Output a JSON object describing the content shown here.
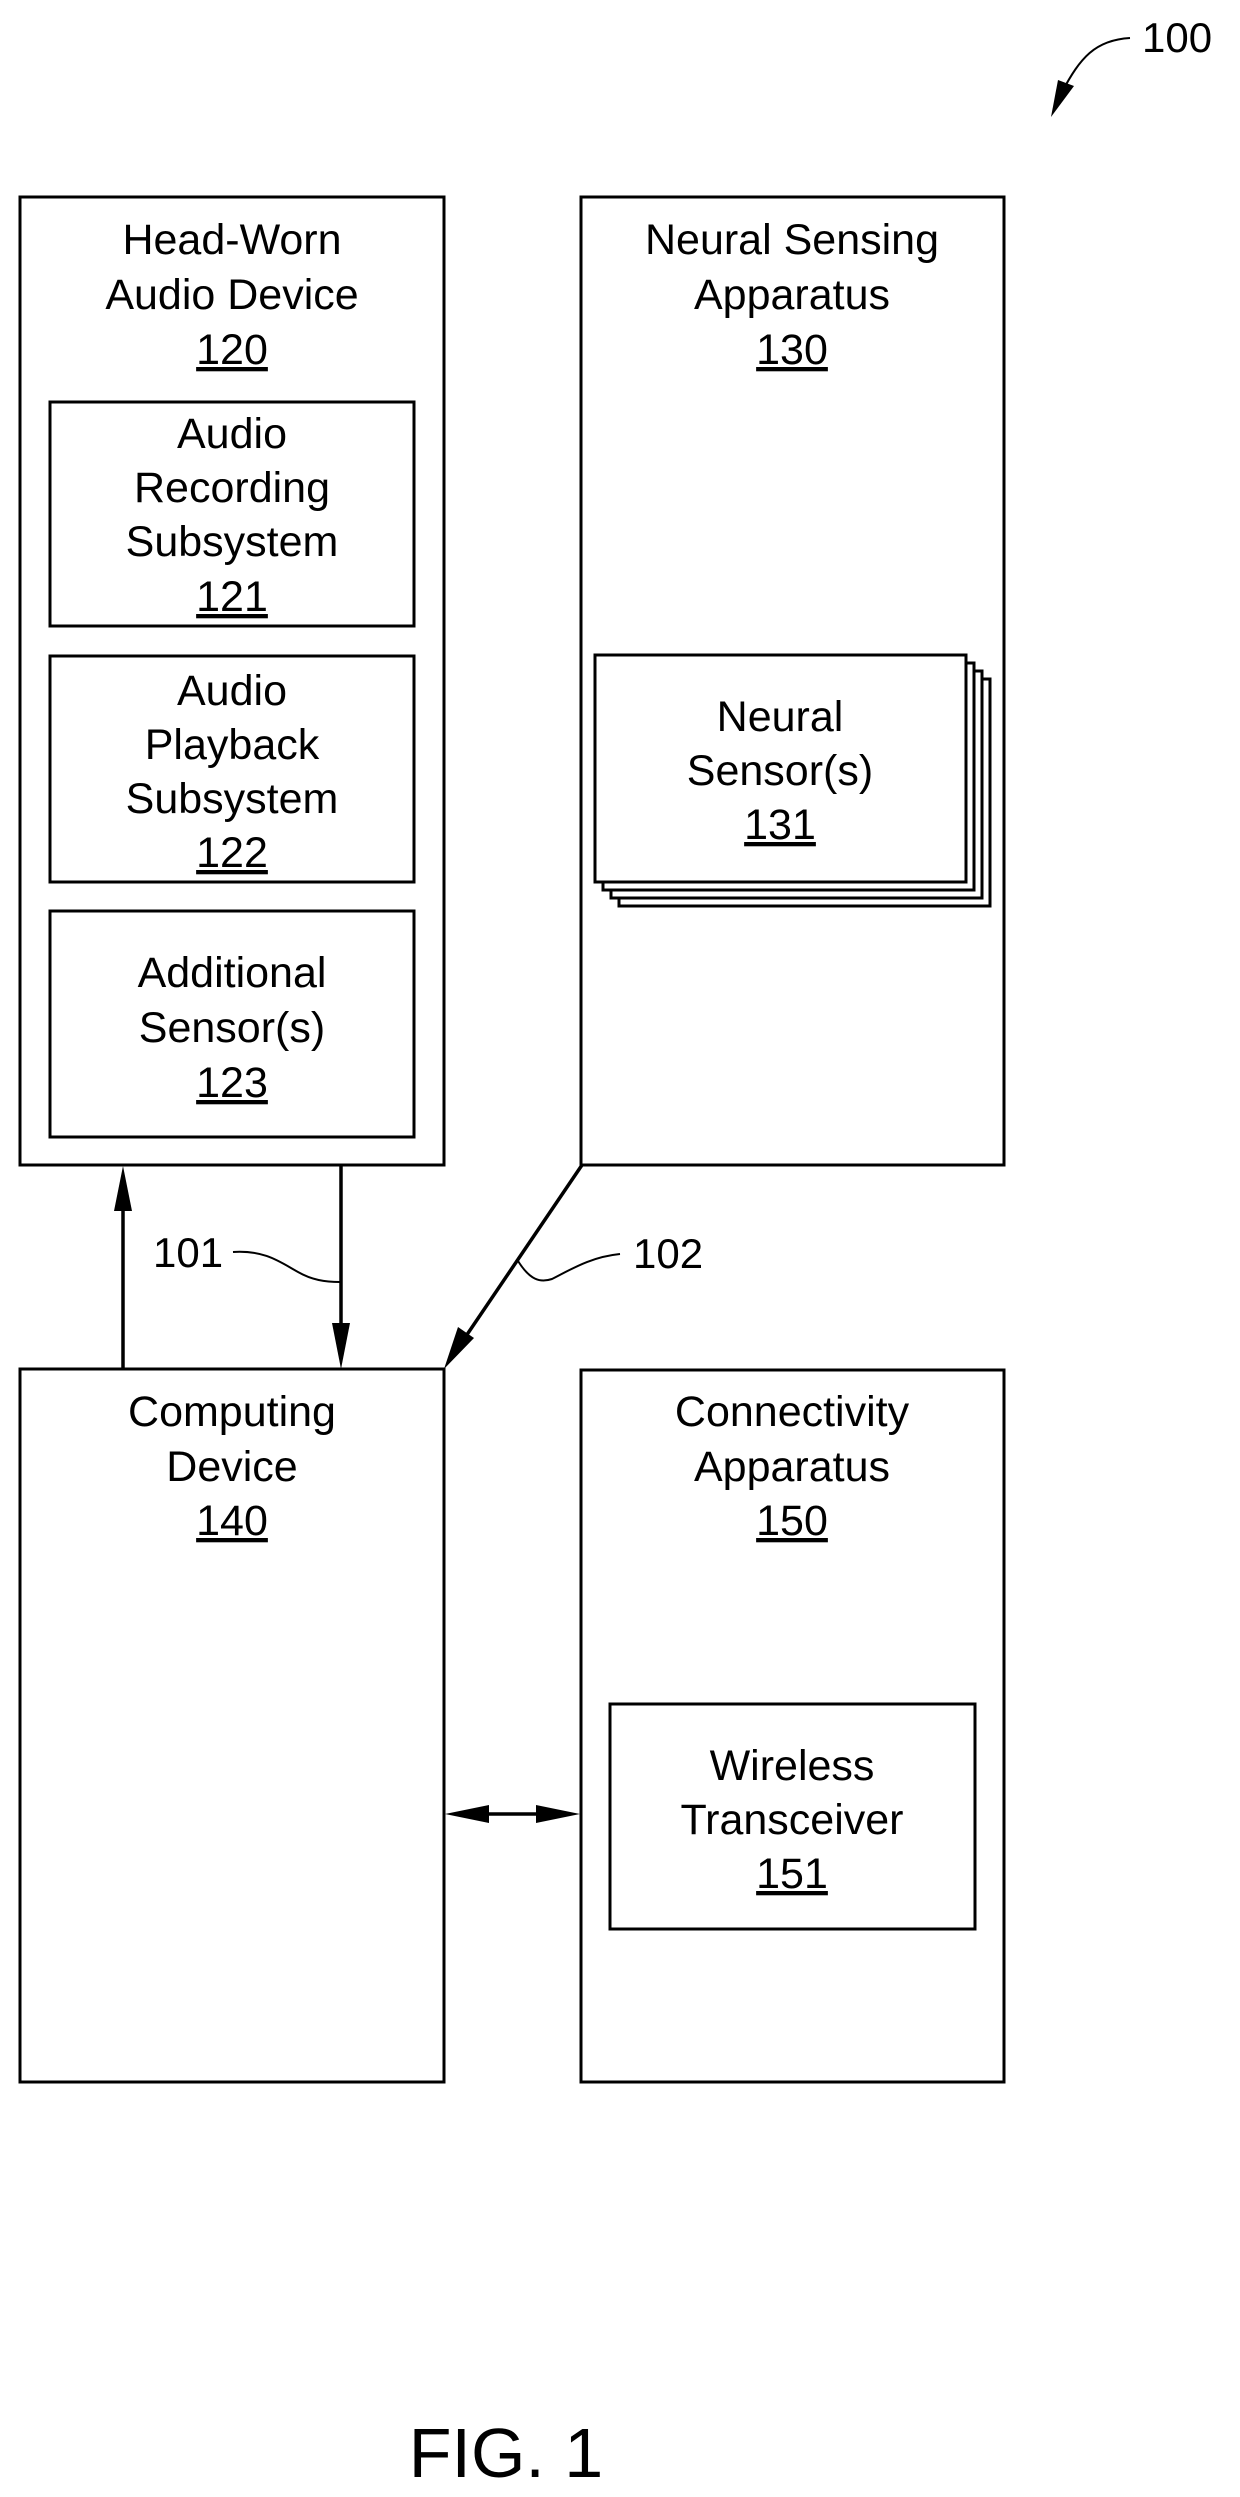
{
  "figure": {
    "reference": "100",
    "caption": "FIG. 1"
  },
  "connections": {
    "c101": {
      "label": "101",
      "description": "Bidirectional link between Head-Worn Audio Device and Computing Device"
    },
    "c102": {
      "label": "102",
      "description": "Link from Neural Sensing Apparatus to Computing Device"
    },
    "c140_150": {
      "label": "",
      "description": "Bidirectional link between Computing Device and Connectivity Apparatus"
    }
  },
  "blocks": {
    "b120": {
      "lines": [
        "Head-Worn",
        "Audio Device"
      ],
      "ref": "120"
    },
    "b121": {
      "lines": [
        "Audio",
        "Recording",
        "Subsystem"
      ],
      "ref": "121"
    },
    "b122": {
      "lines": [
        "Audio",
        "Playback",
        "Subsystem"
      ],
      "ref": "122"
    },
    "b123": {
      "lines": [
        "Additional",
        "Sensor(s)"
      ],
      "ref": "123"
    },
    "b130": {
      "lines": [
        "Neural Sensing",
        "Apparatus"
      ],
      "ref": "130"
    },
    "b131": {
      "lines": [
        "Neural",
        "Sensor(s)"
      ],
      "ref": "131"
    },
    "b140": {
      "lines": [
        "Computing",
        "Device"
      ],
      "ref": "140"
    },
    "b150": {
      "lines": [
        "Connectivity",
        "Apparatus"
      ],
      "ref": "150"
    },
    "b151": {
      "lines": [
        "Wireless",
        "Transceiver"
      ],
      "ref": "151"
    }
  },
  "colors": {
    "stroke": "#000000",
    "background": "#ffffff"
  }
}
